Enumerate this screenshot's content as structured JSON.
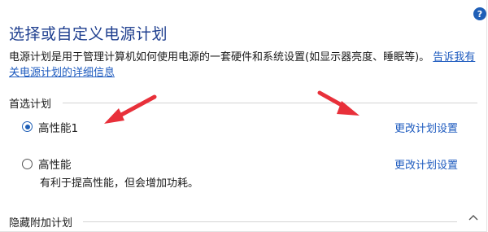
{
  "title": "选择或自定义电源计划",
  "description": {
    "text": "电源计划是用于管理计算机如何使用电源的一套硬件和系统设置(如显示器亮度、睡眠等)。",
    "link": "告诉我有关电源计划的详细信息"
  },
  "preferred_group": {
    "label": "首选计划",
    "plans": [
      {
        "name": "高性能1",
        "selected": true,
        "link": "更改计划设置",
        "description": ""
      },
      {
        "name": "高性能",
        "selected": false,
        "link": "更改计划设置",
        "description": "有利于提高性能，但会增加功耗。"
      }
    ]
  },
  "hidden_group": {
    "label": "隐藏附加计划"
  },
  "icons": {
    "help": "question-mark-icon",
    "collapse": "chevron-up-icon"
  },
  "colors": {
    "accent": "#1f5fb7",
    "link": "#1e5bbf",
    "title": "#1f3f8f",
    "annotation_arrow": "#e8303a"
  }
}
